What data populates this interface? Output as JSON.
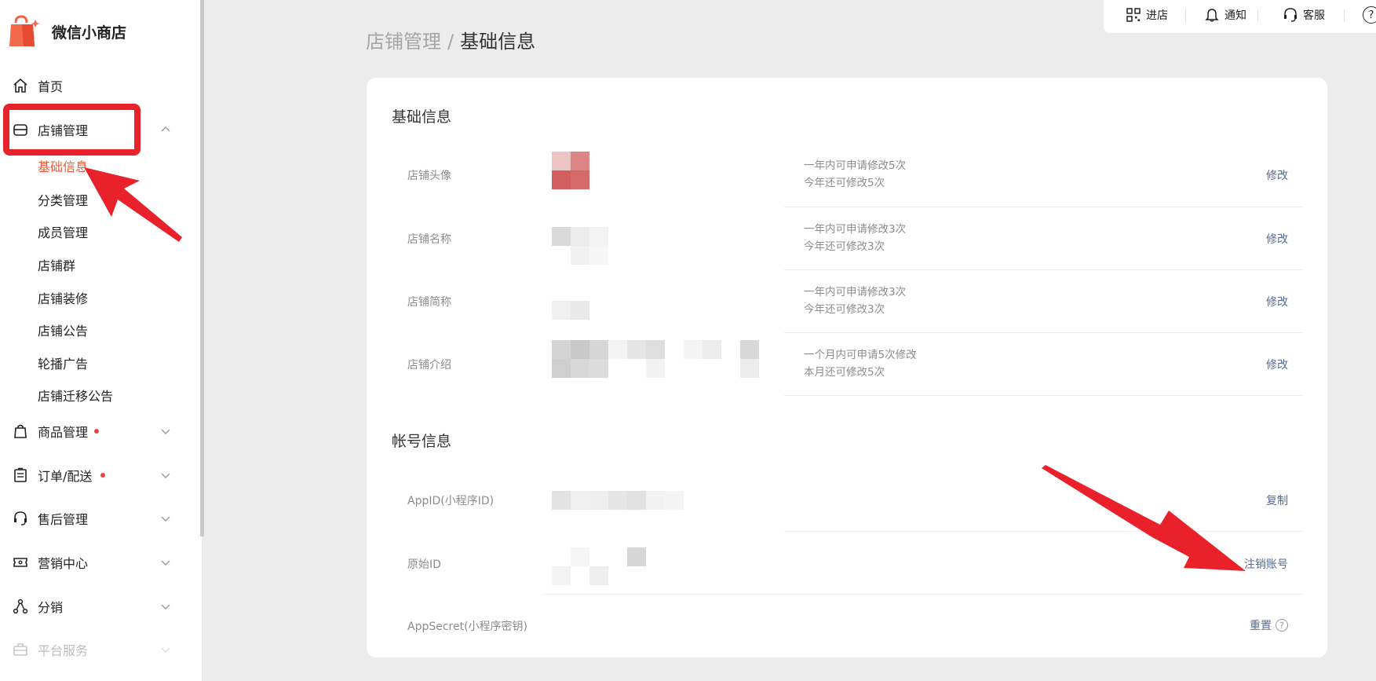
{
  "brand": {
    "name": "微信小商店"
  },
  "sidebar": {
    "home": "首页",
    "store_mgmt": "店铺管理",
    "sub_items": [
      "基础信息",
      "分类管理",
      "成员管理",
      "店铺群",
      "店铺装修",
      "店铺公告",
      "轮播广告",
      "店铺迁移公告"
    ],
    "goods": "商品管理",
    "orders": "订单/配送",
    "after_sales": "售后管理",
    "marketing": "营销中心",
    "distribution": "分销",
    "platform": "平台服务"
  },
  "topbar": {
    "enter_store": "进店",
    "notify": "通知",
    "service": "客服",
    "help": "?"
  },
  "breadcrumb": {
    "parent": "店铺管理",
    "sep": "/",
    "current": "基础信息"
  },
  "basic_info": {
    "title": "基础信息",
    "rows": [
      {
        "label": "店铺头像",
        "desc1": "一年内可申请修改5次",
        "desc2": "今年还可修改5次",
        "action": "修改"
      },
      {
        "label": "店铺名称",
        "desc1": "一年内可申请修改3次",
        "desc2": "今年还可修改3次",
        "action": "修改"
      },
      {
        "label": "店铺简称",
        "desc1": "一年内可申请修改3次",
        "desc2": "今年还可修改3次",
        "action": "修改"
      },
      {
        "label": "店铺介绍",
        "desc1": "一个月内可申请5次修改",
        "desc2": "本月还可修改5次",
        "action": "修改"
      }
    ]
  },
  "account_info": {
    "title": "帐号信息",
    "rows": [
      {
        "label": "AppID(小程序ID)",
        "action": "复制"
      },
      {
        "label": "原始ID",
        "action": "注销账号"
      },
      {
        "label": "AppSecret(小程序密钥)",
        "action": "重置"
      }
    ]
  },
  "colors": {
    "accent": "#f05b3c",
    "link": "#576b95",
    "annotation": "#e8212a"
  }
}
